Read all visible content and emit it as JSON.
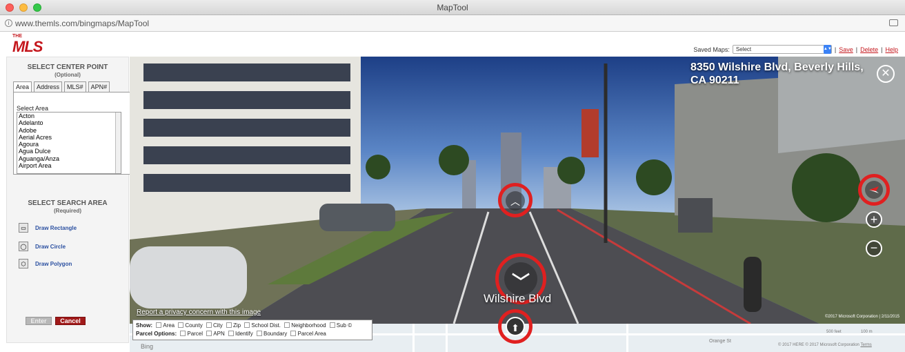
{
  "window": {
    "title": "MapTool"
  },
  "url": "www.themls.com/bingmaps/MapTool",
  "header": {
    "logo": {
      "the": "THE",
      "mls": "MLS"
    },
    "saved_maps_label": "Saved Maps:",
    "saved_maps_value": "Select",
    "links": {
      "save": "Save",
      "delete": "Delete",
      "help": "Help"
    },
    "sep": "|"
  },
  "sidebar": {
    "center_title": "SELECT CENTER POINT",
    "center_sub": "(Optional)",
    "tabs": [
      "Area",
      "Address",
      "MLS#",
      "APN#"
    ],
    "area_label": "Select Area",
    "areas": [
      "Acton",
      "Adelanto",
      "Adobe",
      "Aerial Acres",
      "Agoura",
      "Agua Dulce",
      "Aguanga/Anza",
      "Airport Area"
    ],
    "search_title": "SELECT SEARCH AREA",
    "search_sub": "(Required)",
    "draw": [
      "Draw Rectangle",
      "Draw Circle",
      "Draw Polygon"
    ],
    "enter": "Enter",
    "cancel": "Cancel"
  },
  "street": {
    "address": "8350 Wilshire Blvd, Beverly Hills, CA 90211",
    "street_name": "Wilshire Blvd",
    "privacy": "Report a privacy concern with this image",
    "copyright": "©2017 Microsoft Corporation | 2/11/2015",
    "close_glyph": "✕",
    "up_glyph": "︿",
    "down_glyph": "﹀",
    "zoom_in": "+",
    "zoom_out": "−"
  },
  "show": {
    "show_label": "Show:",
    "show_items": [
      "Area",
      "County",
      "City",
      "Zip",
      "School Dist.",
      "Neighborhood",
      "Sub ©"
    ],
    "parcel_label": "Parcel Options:",
    "parcel_items": [
      "Parcel",
      "APN",
      "Identify",
      "Boundary",
      "Parcel Area"
    ]
  },
  "minimap": {
    "bing": "Bing",
    "scale_ft": "500 feet",
    "scale_m": "100 m",
    "copyright": "© 2017 HERE © 2017 Microsoft Corporation",
    "terms": "Terms",
    "street_orange": "Orange St"
  },
  "colors": {
    "brand_red": "#c4161c",
    "highlight_ring": "#e02020",
    "link_blue": "#2a4fa0"
  }
}
